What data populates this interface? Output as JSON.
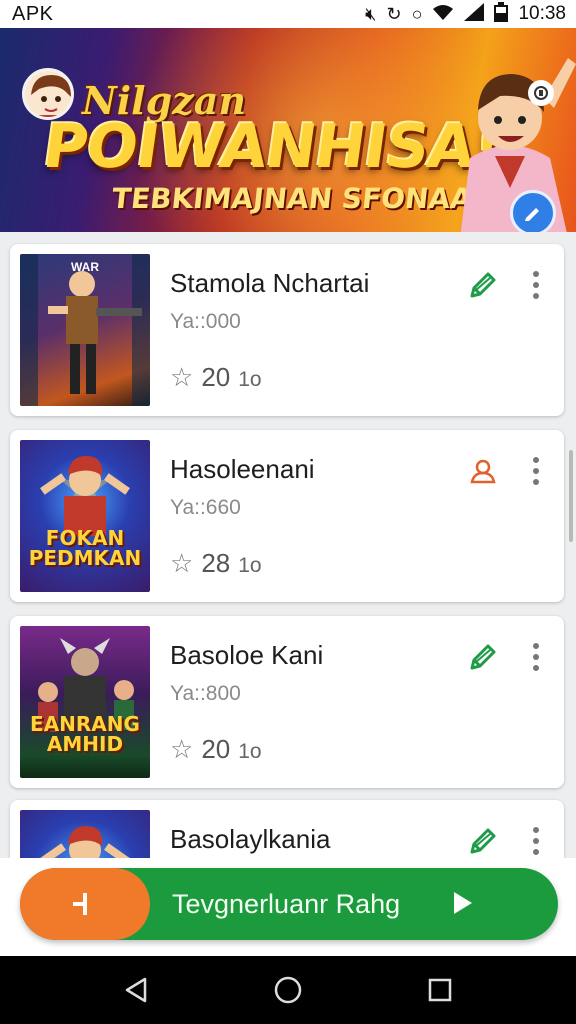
{
  "status_bar": {
    "left_label": "APK",
    "time": "10:38"
  },
  "banner": {
    "small_title": "Nilgzan",
    "big_title": "POIWANHISA!",
    "subtitle": "TEBKIMAJNAN SFONAAI"
  },
  "apps": [
    {
      "title": "Stamola Nchartai",
      "size": "Ya::000",
      "rating": "20",
      "rating_unit": "1o",
      "action": "edit",
      "thumb_text": "",
      "thumb_top": "WAR"
    },
    {
      "title": "Hasoleenani",
      "size": "Ya::660",
      "rating": "28",
      "rating_unit": "1o",
      "action": "user",
      "thumb_text": "FOKAN PEDMKAN",
      "thumb_top": ""
    },
    {
      "title": "Basoloe Kani",
      "size": "Ya::800",
      "rating": "20",
      "rating_unit": "1o",
      "action": "edit",
      "thumb_text": "EANRANG AMHID",
      "thumb_top": ""
    },
    {
      "title": "Basolaylkania",
      "size": "",
      "rating": "",
      "rating_unit": "",
      "action": "edit",
      "thumb_text": "",
      "thumb_top": ""
    }
  ],
  "cta": {
    "label": "Tevgnerluanr Rahg"
  },
  "icons": {
    "star": "☆"
  },
  "colors": {
    "green": "#1c9b3e",
    "orange": "#f07a2a",
    "fab_blue": "#2f7fe6",
    "action_green": "#1e9b46",
    "action_orange": "#e0622a"
  }
}
